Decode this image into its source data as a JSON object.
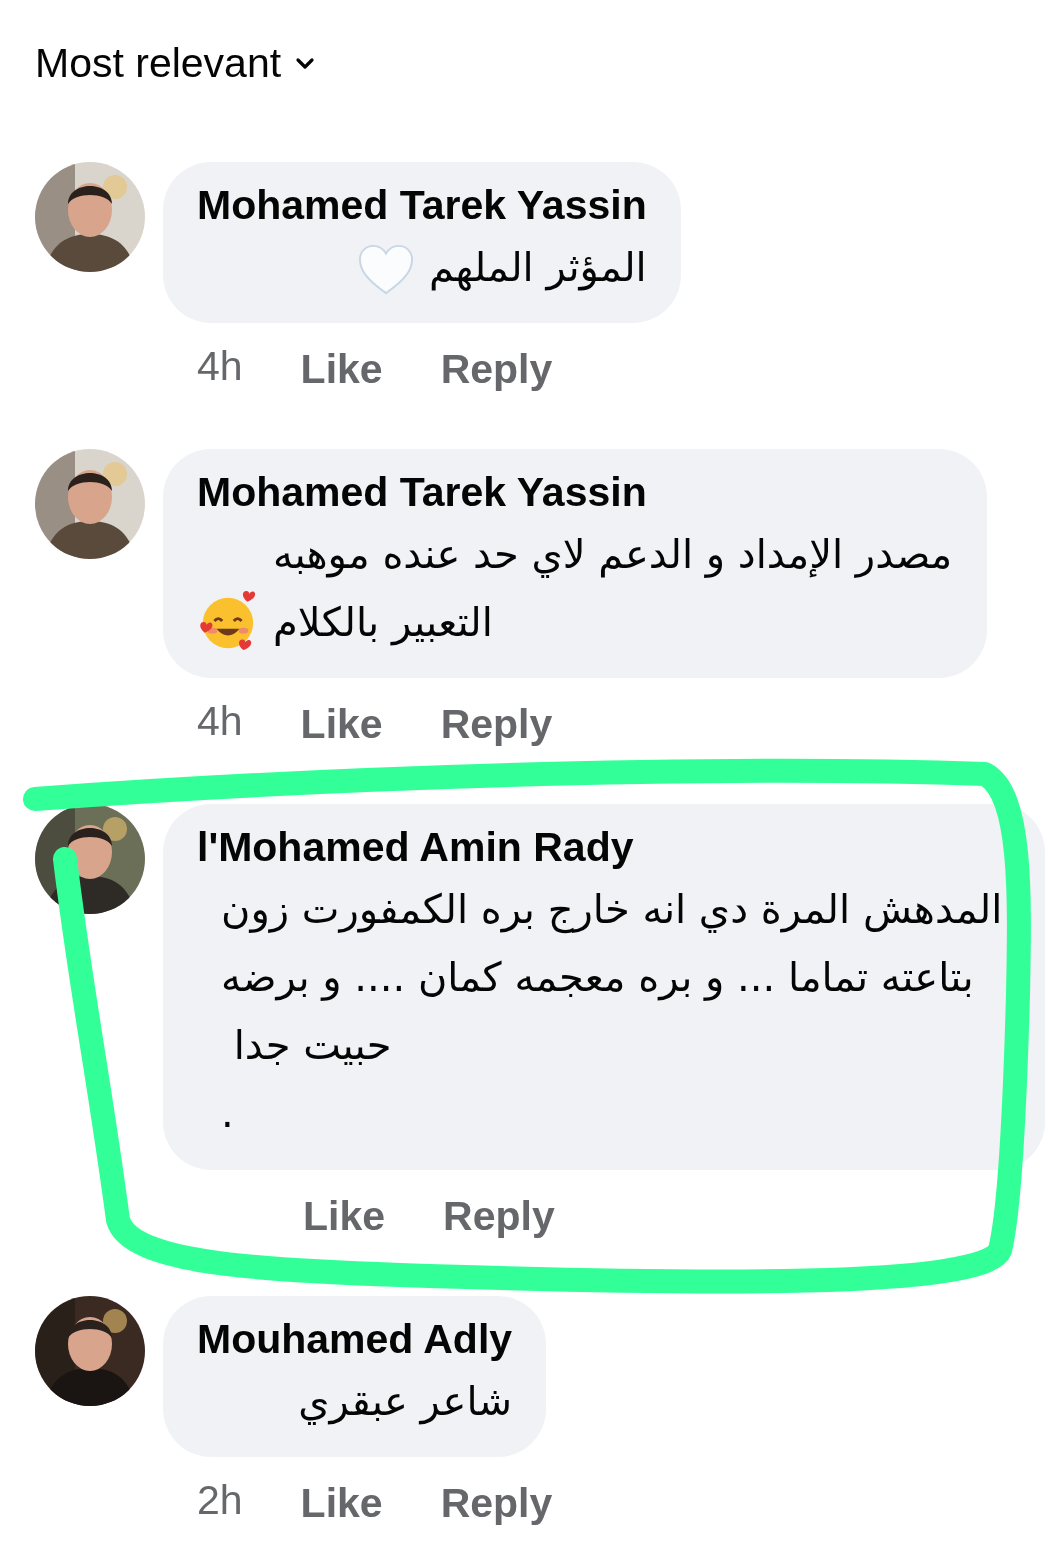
{
  "sort": {
    "label": "Most relevant"
  },
  "comments": [
    {
      "kind": "heart",
      "author": "Mohamed Tarek Yassin",
      "body": "المؤثر الملهم",
      "time": "4h",
      "like": "Like",
      "reply": "Reply"
    },
    {
      "kind": "smiley",
      "author": "Mohamed Tarek Yassin",
      "body": "مصدر الإمداد و الدعم لاي حد عنده موهبه التعبير بالكلام",
      "time": "4h",
      "like": "Like",
      "reply": "Reply"
    },
    {
      "kind": "plain",
      "author": "l'Mohamed Amin Rady",
      "body": "المدهش المرة دي انه خارج بره الكمفورت زون بتاعته تماما ... و بره معجمه كمان .... و برضه حبيت جدا \n.",
      "highlighted": true,
      "like": "Like",
      "reply": "Reply"
    },
    {
      "kind": "plain",
      "author": "Mouhamed Adly",
      "body": "شاعر عبقري",
      "time": "2h",
      "like": "Like",
      "reply": "Reply"
    }
  ]
}
